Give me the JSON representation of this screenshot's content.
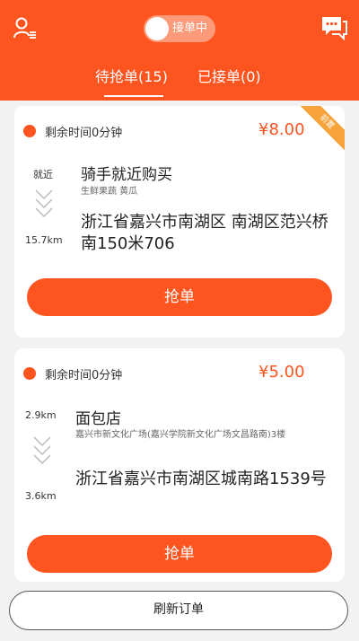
{
  "header": {
    "toggle_label": "接单中",
    "tabs": [
      {
        "label": "待抢单(15)",
        "active": true
      },
      {
        "label": "已接单(0)",
        "active": false
      }
    ],
    "icons": {
      "user": "user-list-icon",
      "messages": "chat-bubbles-icon"
    }
  },
  "orders": [
    {
      "remaining": "剩余时间0分钟",
      "price": "¥8.00",
      "badge": "前置",
      "distance_shop": "就近",
      "distance_customer": "15.7km",
      "shop": "骑手就近购买",
      "shop_category": "生鲜果蔬  黄瓜",
      "address": "浙江省嘉兴市南湖区 南湖区范兴桥南150米706",
      "grab_label": "抢单"
    },
    {
      "remaining": "剩余时间0分钟",
      "price": "¥5.00",
      "distance_shop": "2.9km",
      "distance_customer": "3.6km",
      "shop": "面包店",
      "shop_category": "嘉兴市新文化广场(嘉兴学院新文化广场文昌路南)3楼",
      "address": "浙江省嘉兴市南湖区城南路1539号",
      "grab_label": "抢单"
    }
  ],
  "refresh_label": "刷新订单",
  "colors": {
    "accent": "#fd5420",
    "badge": "#f7a23a",
    "background": "#f2f2f2"
  }
}
